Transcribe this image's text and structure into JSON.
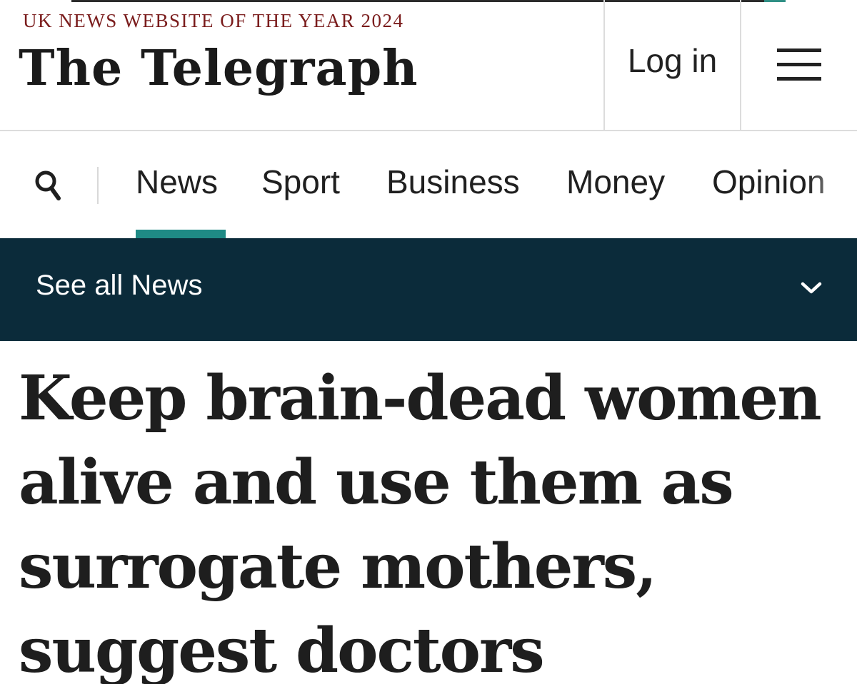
{
  "masthead": {
    "award": "UK NEWS WEBSITE OF THE YEAR 2024",
    "logo": "The Telegraph",
    "login_label": "Log in",
    "menu_icon": "hamburger-menu-icon"
  },
  "nav": {
    "search_icon": "search-icon",
    "items": [
      {
        "label": "News",
        "active": true
      },
      {
        "label": "Sport"
      },
      {
        "label": "Business"
      },
      {
        "label": "Money"
      },
      {
        "label": "Opinion"
      }
    ],
    "accent_color": "#1f8a85"
  },
  "see_all": {
    "label": "See all News",
    "icon": "chevron-down-icon",
    "background": "#0b2b3a"
  },
  "article": {
    "headline_lines": [
      "Keep brain-dead women",
      "alive and use them as",
      "surrogate mothers,",
      "suggest doctors"
    ]
  }
}
